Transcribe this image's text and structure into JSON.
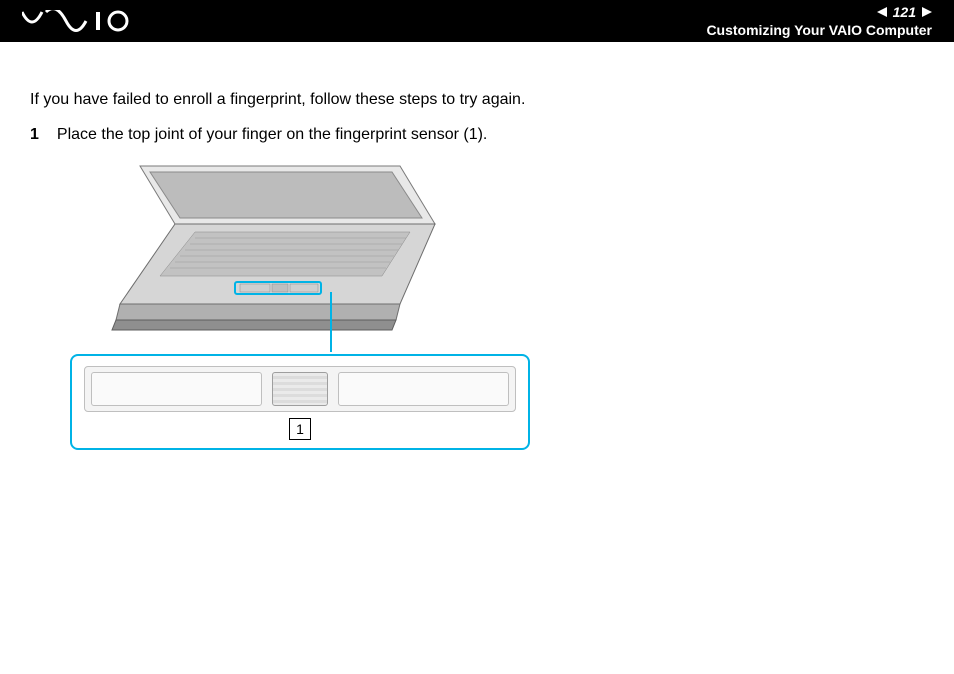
{
  "header": {
    "page_number": "121",
    "section_title": "Customizing Your VAIO Computer"
  },
  "content": {
    "intro": "If you have failed to enroll a fingerprint, follow these steps to try again.",
    "steps": [
      {
        "num": "1",
        "text": "Place the top joint of your finger on the fingerprint sensor (1)."
      }
    ],
    "callout_label": "1"
  },
  "colors": {
    "accent": "#00b3e6",
    "header_bg": "#000000"
  }
}
